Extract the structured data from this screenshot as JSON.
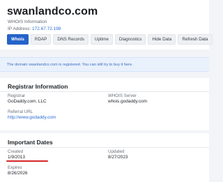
{
  "header": {
    "domain": "swanlandco.com",
    "subtitle": "WHOIS Information",
    "ip_label": "IP Address:",
    "ip_value": "172.67.72.198"
  },
  "tabs": [
    {
      "label": "Whois",
      "active": true
    },
    {
      "label": "RDAP",
      "active": false
    },
    {
      "label": "DNS Records",
      "active": false
    },
    {
      "label": "Uptime",
      "active": false
    },
    {
      "label": "Diagnostics",
      "active": false
    },
    {
      "label": "Hide Data",
      "active": false
    },
    {
      "label": "Refresh Data",
      "active": false
    }
  ],
  "notice": {
    "text": "The domain swanlandco.com is registered. You can still try to buy it here."
  },
  "registrar_info": {
    "title": "Registrar Information",
    "registrar_label": "Registrar",
    "registrar_value": "GoDaddy.com, LLC",
    "whois_server_label": "WHOIS Server",
    "whois_server_value": "whois.godaddy.com",
    "referral_label": "Referral URL",
    "referral_value": "http://www.godaddy.com"
  },
  "important_dates": {
    "title": "Important Dates",
    "created_label": "Created",
    "created_value": "1/9/2013",
    "updated_label": "Updated",
    "updated_value": "8/27/2023",
    "expires_label": "Expires",
    "expires_value": "8/26/2026"
  },
  "colors": {
    "accent": "#2563c9",
    "link": "#2b6cd4",
    "notice_bg": "#e9f1fd",
    "highlight_underline": "#d62828"
  }
}
